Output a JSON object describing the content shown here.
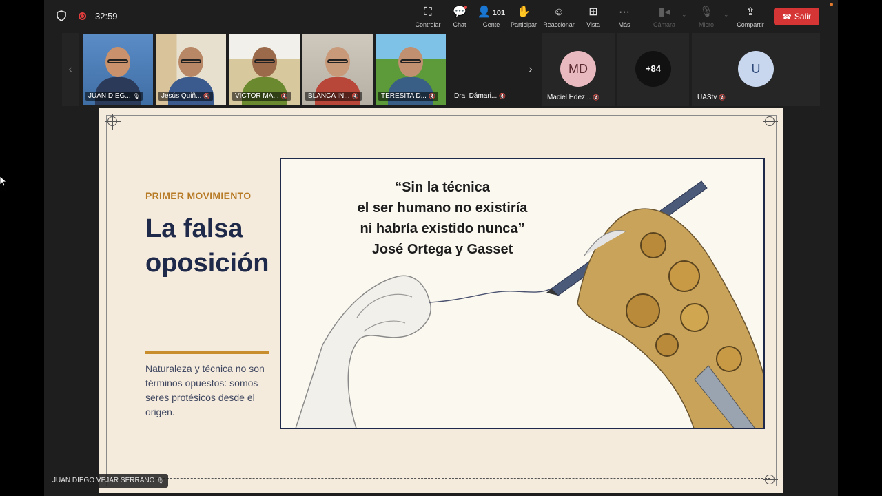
{
  "meeting": {
    "timer": "32:59",
    "toolbar": {
      "controlar": "Controlar",
      "chat": "Chat",
      "gente": "Gente",
      "gente_count": "101",
      "participar": "Participar",
      "reaccionar": "Reaccionar",
      "vista": "Vista",
      "mas": "Más",
      "camara": "Cámara",
      "micro": "Micro",
      "compartir": "Compartir",
      "salir": "Salir"
    }
  },
  "participants": [
    {
      "name": "JUAN DIEG..."
    },
    {
      "name": "Jesús Quiñ..."
    },
    {
      "name": "VICTOR MA..."
    },
    {
      "name": "BLANCA IN..."
    },
    {
      "name": "TERESITA D..."
    },
    {
      "name": "Dra. Dámari..."
    }
  ],
  "avatars": [
    {
      "initials": "MD",
      "name": "Maciel Hdez...",
      "color": "#e8b9bf"
    },
    {
      "initials": "+84",
      "name": "",
      "color": "#111111"
    },
    {
      "initials": "U",
      "name": "UAStv",
      "color": "#c8d7ee"
    }
  ],
  "slide": {
    "kicker": "PRIMER MOVIMIENTO",
    "title": "La falsa oposición",
    "description": "Naturaleza y técnica no son términos opuestos: somos seres protésicos desde el origen.",
    "quote_lines": [
      "“Sin la técnica",
      "el ser humano no existiría",
      "ni habría existido nunca”",
      "José Ortega y Gasset"
    ]
  },
  "presenter": "JUAN DIEGO VEJAR SERRANO",
  "colors": {
    "accent_gold": "#c88d2c",
    "title_navy": "#1f2a4a",
    "leave_red": "#d53535",
    "active_outline": "#6f8ce0"
  },
  "icons": [
    "shield-icon",
    "record-icon",
    "control-icon",
    "chat-icon",
    "people-icon",
    "hand-icon",
    "smile-icon",
    "grid-icon",
    "more-icon",
    "camera-off-icon",
    "mic-off-icon",
    "share-icon",
    "phone-icon"
  ]
}
